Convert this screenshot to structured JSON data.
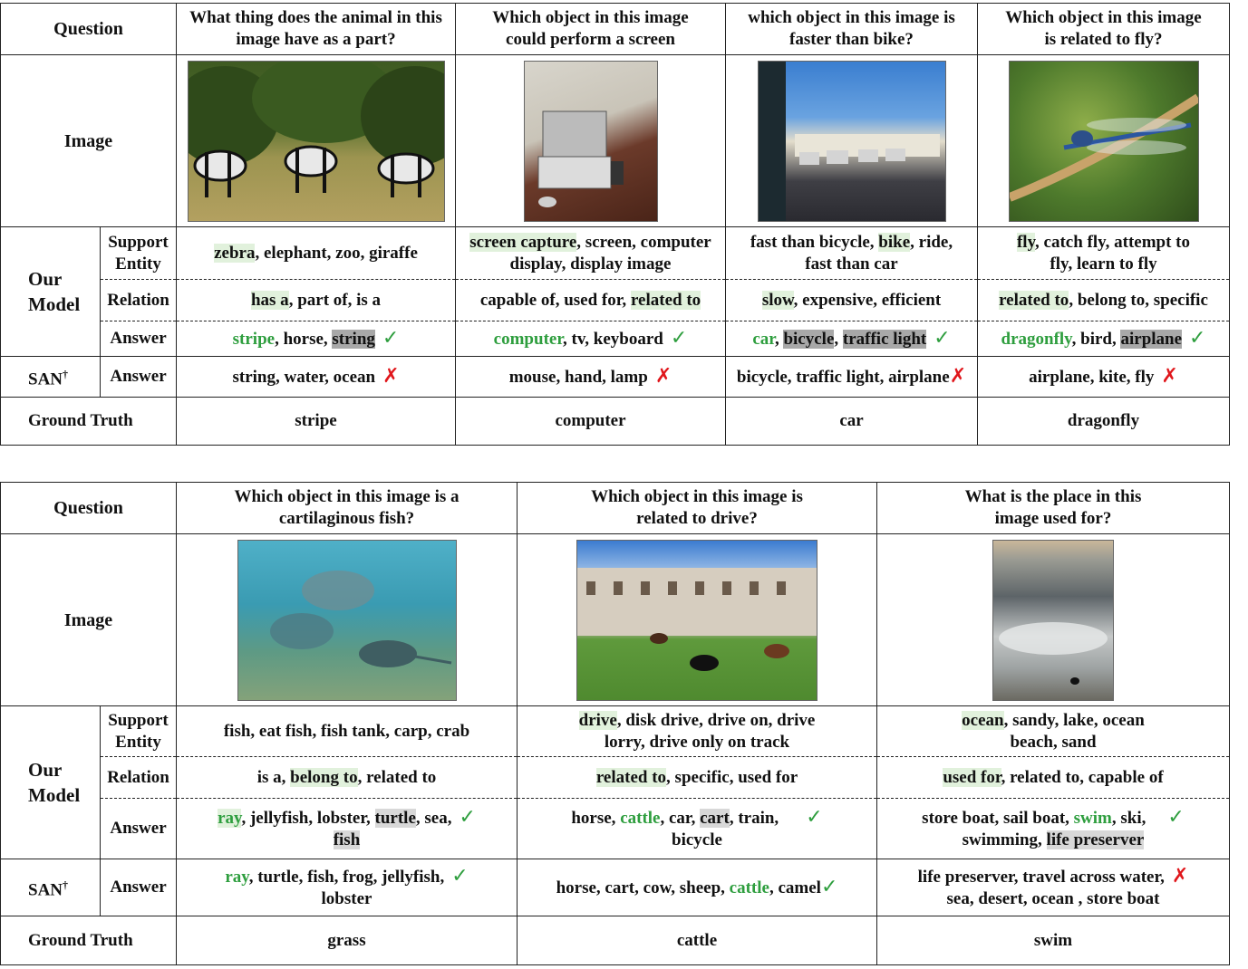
{
  "labels": {
    "question": "Question",
    "image": "Image",
    "our_model": [
      "Our",
      "Model"
    ],
    "support_entity": [
      "Support",
      "Entity"
    ],
    "relation": "Relation",
    "answer": "Answer",
    "san": "SAN",
    "san_mark": "†",
    "ground_truth": "Ground Truth"
  },
  "marks": {
    "correct": "✓",
    "wrong": "✗"
  },
  "table1": {
    "questions": [
      [
        "What thing does the animal in this",
        "image have as a part?"
      ],
      [
        "Which object in this image",
        "could perform a screen"
      ],
      [
        "which object in this image is",
        "faster than bike?"
      ],
      [
        "Which object in this image",
        "is related to fly?"
      ]
    ],
    "images": [
      "zebra-photo",
      "computer-desk-photo",
      "street-traffic-photo",
      "dragonfly-photo"
    ],
    "support_entity": [
      {
        "a": "zebra",
        "b": ", elephant, zoo, giraffe"
      },
      {
        "a": "screen capture",
        "b": ", screen, computer",
        "c": "display, display image"
      },
      {
        "a": "fast than bicycle, ",
        "b": "bike",
        "c": ", ride,",
        "d": "fast than car"
      },
      {
        "a": "fly",
        "b": ", catch fly, attempt to",
        "c": "fly, learn to fly"
      }
    ],
    "relation": [
      {
        "a": "has a",
        "b": ", part of, is a"
      },
      {
        "a": "capable of, used for, ",
        "b": "related to"
      },
      {
        "a": "slow",
        "b": ", expensive, efficient"
      },
      {
        "a": "related to",
        "b": ", belong to, specific"
      }
    ],
    "answer": [
      {
        "a": "stripe",
        "b": ", horse, ",
        "c": "string"
      },
      {
        "a": "computer",
        "b": ", tv, keyboard"
      },
      {
        "a": "car",
        "b": ", ",
        "c": "bicycle",
        "d": ", ",
        "e": "traffic light"
      },
      {
        "a": "dragonfly",
        "b": ", bird, ",
        "c": "airplane"
      }
    ],
    "san_answer": [
      "string, water, ocean",
      "mouse, hand, lamp",
      "bicycle, traffic light, airplane",
      "airplane, kite, fly"
    ],
    "ground_truth": [
      "stripe",
      "computer",
      "car",
      "dragonfly"
    ]
  },
  "table2": {
    "questions": [
      [
        "Which object in this image is a",
        "cartilaginous fish?"
      ],
      [
        "Which object in this image is",
        "related to drive?"
      ],
      [
        "What is the place in this",
        "image used for?"
      ]
    ],
    "images": [
      "underwater-rays-photo",
      "cattle-building-photo",
      "ocean-waves-photo"
    ],
    "support_entity": [
      {
        "a": "fish, eat fish, fish tank, carp, crab"
      },
      {
        "a": "drive",
        "b": ", disk drive, drive on, drive",
        "c": "lorry, drive only on track"
      },
      {
        "a": "ocean",
        "b": ", sandy, lake, ocean",
        "c": "beach, sand"
      }
    ],
    "relation": [
      {
        "a": "is a, ",
        "b": "belong to",
        "c": ", related to"
      },
      {
        "a": "related to",
        "b": ", specific, used for"
      },
      {
        "a": "used for",
        "b": ", related to, capable of"
      }
    ],
    "answer": [
      {
        "a": "ray",
        "b": ", jellyfish, lobster, ",
        "c": "turtle",
        "d": ", sea,",
        "e": "fish"
      },
      {
        "a": "horse, ",
        "b": "cattle",
        "c": ", car, ",
        "d": "cart",
        "e": ", train,",
        "f": "bicycle"
      },
      {
        "a": "store boat, sail boat, ",
        "b": "swim",
        "c": ", ski,",
        "d": "swimming, ",
        "e": "life preserver"
      }
    ],
    "san_answer": [
      {
        "a": "ray",
        "b": ", turtle, fish, frog, jellyfish,",
        "c": "lobster"
      },
      {
        "a": "horse, cart, cow, sheep, ",
        "b": "cattle",
        "c": ", camel"
      },
      {
        "a": "life preserver, travel across water,",
        "b": "sea, desert, ocean , store boat"
      }
    ],
    "ground_truth": [
      "grass",
      "cattle",
      "swim"
    ]
  }
}
